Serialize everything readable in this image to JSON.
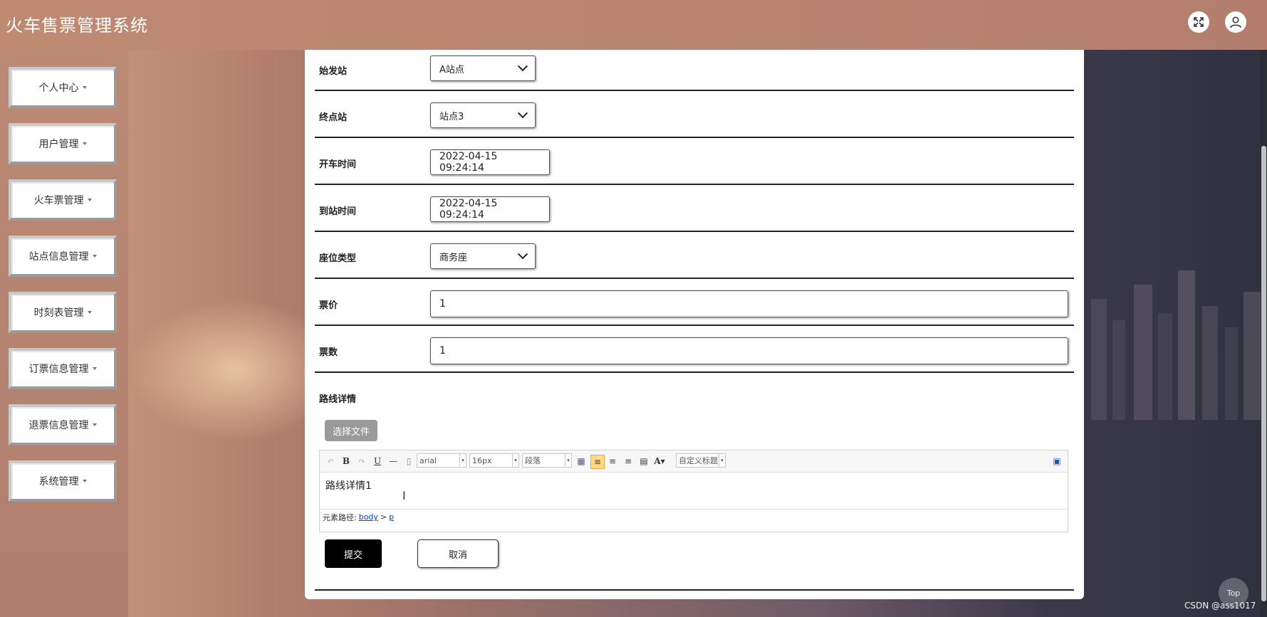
{
  "header": {
    "title": "火车售票管理系统",
    "expand_icon": "expand-icon",
    "user_icon": "user-icon"
  },
  "sidebar": {
    "items": [
      {
        "label": "个人中心"
      },
      {
        "label": "用户管理"
      },
      {
        "label": "火车票管理"
      },
      {
        "label": "站点信息管理"
      },
      {
        "label": "时刻表管理"
      },
      {
        "label": "订票信息管理"
      },
      {
        "label": "退票信息管理"
      },
      {
        "label": "系统管理"
      }
    ]
  },
  "form": {
    "start_station": {
      "label": "始发站",
      "value": "A站点"
    },
    "end_station": {
      "label": "终点站",
      "value": "站点3"
    },
    "depart_time": {
      "label": "开车时间",
      "value": "2022-04-15 09:24:14"
    },
    "arrive_time": {
      "label": "到站时间",
      "value": "2022-04-15 09:24:14"
    },
    "seat_type": {
      "label": "座位类型",
      "value": "商务座"
    },
    "price": {
      "label": "票价",
      "value": "1"
    },
    "quantity": {
      "label": "票数",
      "value": "1"
    },
    "route_details": {
      "label": "路线详情"
    }
  },
  "editor": {
    "file_button": "选择文件",
    "font_family": "arial",
    "font_size": "16px",
    "paragraph": "段落",
    "custom_title": "自定义标题",
    "content": "路线详情1",
    "path_label": "元素路径:",
    "path_body": "body",
    "path_sep": ">",
    "path_p": "p"
  },
  "actions": {
    "submit": "提交",
    "cancel": "取消"
  },
  "top_button": "Top",
  "watermark": "CSDN @ass1017"
}
